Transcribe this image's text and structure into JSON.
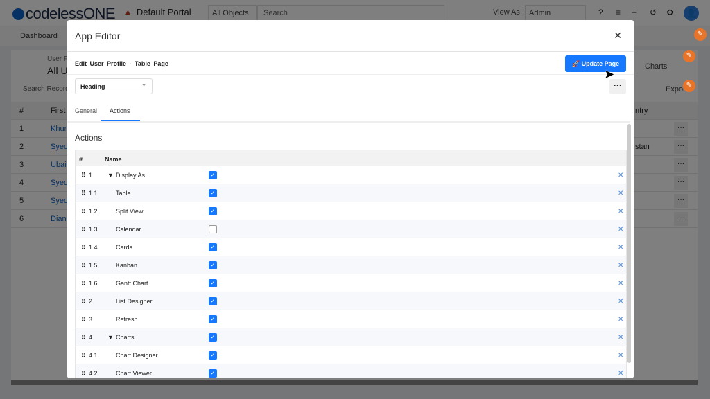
{
  "topnav": {
    "logo": "codelessONE",
    "portal": "Default Portal",
    "object_filter": "All Objects",
    "search_placeholder": "Search",
    "view_as_label": "View As :",
    "view_as_value": "Admin"
  },
  "subnav": {
    "dashboard": "Dashboard"
  },
  "background": {
    "subtitle": "User P",
    "title": "All U",
    "search": "Search Record",
    "charts": "Charts",
    "export": "Export",
    "columns": [
      "#",
      "First",
      "ntry"
    ],
    "rows": [
      {
        "n": "1",
        "name": "Khur",
        "country": ""
      },
      {
        "n": "2",
        "name": "Syed",
        "country": "stan"
      },
      {
        "n": "3",
        "name": "Ubai",
        "country": ""
      },
      {
        "n": "4",
        "name": "Syed",
        "country": ""
      },
      {
        "n": "5",
        "name": "Syed",
        "country": ""
      },
      {
        "n": "6",
        "name": "Dian",
        "country": ""
      }
    ]
  },
  "modal": {
    "title": "App Editor",
    "breadcrumb": "Edit User Profile - Table Page",
    "update_button": "Update Page",
    "heading_select": "Heading",
    "tabs": [
      {
        "label": "General",
        "active": false
      },
      {
        "label": "Actions",
        "active": true
      }
    ],
    "section_title": "Actions",
    "columns": {
      "num": "#",
      "name": "Name"
    },
    "actions": [
      {
        "num": "1",
        "name": "Display As",
        "checked": true,
        "expanded": true,
        "level": 0
      },
      {
        "num": "1.1",
        "name": "Table",
        "checked": true,
        "level": 1
      },
      {
        "num": "1.2",
        "name": "Split View",
        "checked": true,
        "level": 1
      },
      {
        "num": "1.3",
        "name": "Calendar",
        "checked": false,
        "level": 1
      },
      {
        "num": "1.4",
        "name": "Cards",
        "checked": true,
        "level": 1
      },
      {
        "num": "1.5",
        "name": "Kanban",
        "checked": true,
        "level": 1
      },
      {
        "num": "1.6",
        "name": "Gantt Chart",
        "checked": true,
        "level": 1
      },
      {
        "num": "2",
        "name": "List Designer",
        "checked": true,
        "level": 1
      },
      {
        "num": "3",
        "name": "Refresh",
        "checked": true,
        "level": 1
      },
      {
        "num": "4",
        "name": "Charts",
        "checked": true,
        "expanded": true,
        "level": 0
      },
      {
        "num": "4.1",
        "name": "Chart Designer",
        "checked": true,
        "level": 1
      },
      {
        "num": "4.2",
        "name": "Chart Viewer",
        "checked": true,
        "level": 1
      }
    ]
  },
  "colors": {
    "primary": "#1677ff",
    "accent": "#e8742a"
  }
}
